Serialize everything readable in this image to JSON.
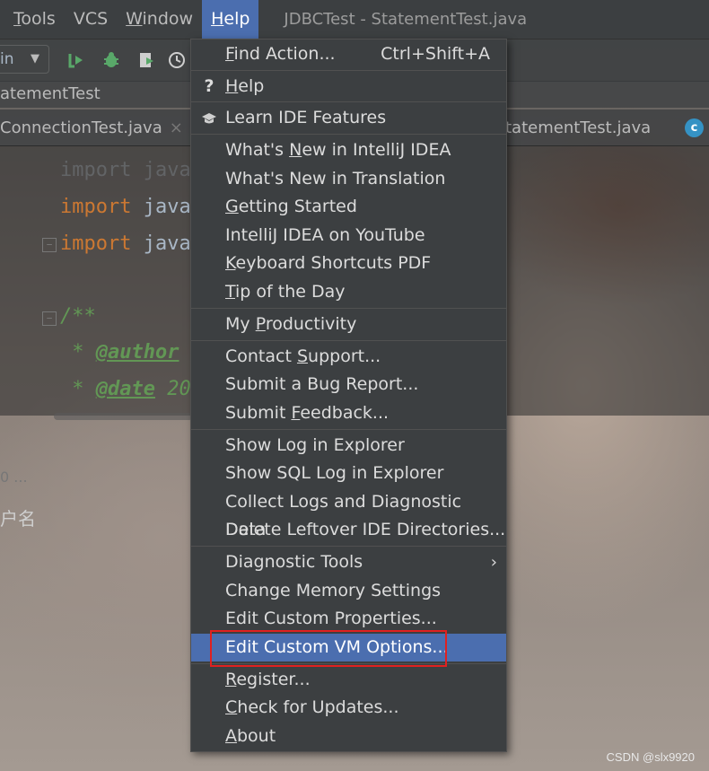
{
  "menubar": {
    "items": [
      {
        "label": "Tools",
        "mnemonic": "T",
        "rest": "ools"
      },
      {
        "label": "VCS",
        "mnemonic": "",
        "rest": "VCS"
      },
      {
        "label": "Window",
        "mnemonic": "W",
        "rest": "indow"
      },
      {
        "label": "Help",
        "mnemonic": "H",
        "rest": "elp"
      }
    ],
    "window_title": "JDBCTest - StatementTest.java"
  },
  "toolbar": {
    "run_config_text": "in",
    "dropdown_arrow": "▼"
  },
  "navbar": {
    "breadcrumb": "atementTest"
  },
  "tabs": {
    "left_tab": "ConnectionTest.java",
    "left_tab_close": "×",
    "right_tab": "tatementTest.java",
    "right_badge": "c"
  },
  "editor": {
    "line0": "import java",
    "line1_kw": "import",
    "line1_rest": " java",
    "line2_kw": "import",
    "line2_rest": " java",
    "line3": "/**",
    "line4_prefix": " * ",
    "line4_tag": "@author",
    "line5_prefix": " * ",
    "line5_tag": "@date",
    "line5_rest": " 20",
    "line6": " */"
  },
  "bottom": {
    "header": "0 ...",
    "console_text": "户名"
  },
  "help_menu": {
    "items": [
      {
        "pre": "",
        "mn": "F",
        "post": "ind Action...",
        "shortcut": "Ctrl+Shift+A",
        "icon": ""
      },
      {
        "pre": "",
        "mn": "H",
        "post": "elp",
        "shortcut": "",
        "icon": "?"
      },
      {
        "pre": "Learn IDE Features",
        "mn": "",
        "post": "",
        "shortcut": "",
        "icon": "🎓"
      },
      {
        "pre": "What's ",
        "mn": "N",
        "post": "ew in IntelliJ IDEA",
        "shortcut": "",
        "icon": ""
      },
      {
        "pre": "What's New in Translation",
        "mn": "",
        "post": "",
        "shortcut": "",
        "icon": ""
      },
      {
        "pre": "",
        "mn": "G",
        "post": "etting Started",
        "shortcut": "",
        "icon": ""
      },
      {
        "pre": "IntelliJ IDEA on YouTube",
        "mn": "",
        "post": "",
        "shortcut": "",
        "icon": ""
      },
      {
        "pre": "",
        "mn": "K",
        "post": "eyboard Shortcuts PDF",
        "shortcut": "",
        "icon": ""
      },
      {
        "pre": "",
        "mn": "T",
        "post": "ip of the Day",
        "shortcut": "",
        "icon": ""
      },
      {
        "pre": "My ",
        "mn": "P",
        "post": "roductivity",
        "shortcut": "",
        "icon": ""
      },
      {
        "pre": "Contact ",
        "mn": "S",
        "post": "upport...",
        "shortcut": "",
        "icon": ""
      },
      {
        "pre": "Submit a Bug Report...",
        "mn": "",
        "post": "",
        "shortcut": "",
        "icon": ""
      },
      {
        "pre": "Submit ",
        "mn": "F",
        "post": "eedback...",
        "shortcut": "",
        "icon": ""
      },
      {
        "pre": "Show Log in Explorer",
        "mn": "",
        "post": "",
        "shortcut": "",
        "icon": ""
      },
      {
        "pre": "Show SQL Log in Explorer",
        "mn": "",
        "post": "",
        "shortcut": "",
        "icon": ""
      },
      {
        "pre": "Collect Logs and Diagnostic Data",
        "mn": "",
        "post": "",
        "shortcut": "",
        "icon": ""
      },
      {
        "pre": "Delete Leftover IDE Directories...",
        "mn": "",
        "post": "",
        "shortcut": "",
        "icon": ""
      },
      {
        "pre": "Diagnostic Tools",
        "mn": "",
        "post": "",
        "shortcut": "",
        "icon": "",
        "submenu": "›"
      },
      {
        "pre": "Change Memory Settings",
        "mn": "",
        "post": "",
        "shortcut": "",
        "icon": ""
      },
      {
        "pre": "Edit Custom Properties...",
        "mn": "",
        "post": "",
        "shortcut": "",
        "icon": ""
      },
      {
        "pre": "Edit Custom VM Options...",
        "mn": "",
        "post": "",
        "shortcut": "",
        "icon": "",
        "selected": true
      },
      {
        "pre": "",
        "mn": "R",
        "post": "egister...",
        "shortcut": "",
        "icon": ""
      },
      {
        "pre": "",
        "mn": "C",
        "post": "heck for Updates...",
        "shortcut": "",
        "icon": ""
      },
      {
        "pre": "",
        "mn": "A",
        "post": "bout",
        "shortcut": "",
        "icon": ""
      }
    ]
  },
  "watermark": "CSDN @slx9920",
  "colors": {
    "selection": "#4b6eaf",
    "menu_bg": "#3c3f41",
    "highlight_box": "#e02020"
  }
}
